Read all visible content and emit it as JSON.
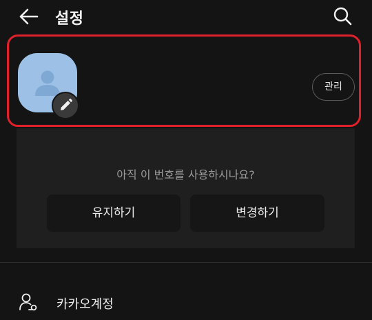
{
  "header": {
    "title": "설정",
    "back_icon": "arrow-left-icon",
    "search_icon": "search-icon"
  },
  "profile": {
    "avatar_icon": "person-icon",
    "edit_icon": "pencil-icon",
    "manage_label": "관리",
    "highlight_color": "#e0202a",
    "avatar_color": "#9dc1e6"
  },
  "number_prompt": {
    "question": "아직 이 번호를 사용하시나요?",
    "keep_label": "유지하기",
    "change_label": "변경하기"
  },
  "menu": {
    "items": [
      {
        "label": "카카오계정",
        "icon": "account-icon"
      }
    ]
  }
}
